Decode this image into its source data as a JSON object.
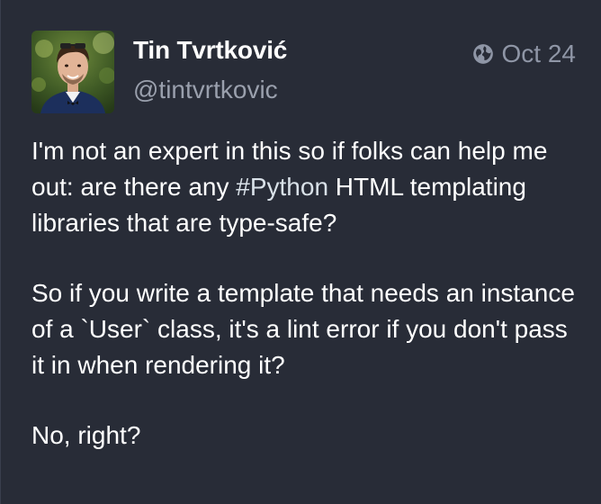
{
  "author": {
    "display_name": "Tin Tvrtković",
    "handle": "@tintvrtkovic"
  },
  "meta": {
    "visibility_icon": "globe-icon",
    "date": "Oct 24"
  },
  "content": {
    "p1_before": "I'm not an expert in this so if folks can help me out: are there any ",
    "p1_hashtag": "#Python",
    "p1_after": " HTML templating libraries that are type-safe?",
    "p2": "So if you write a template that needs an instance of a `User` class, it's a lint error if you don't pass it in when rendering it?",
    "p3": "No, right?"
  },
  "colors": {
    "background": "#282c37",
    "text": "#ffffff",
    "secondary": "#9aa0ad"
  }
}
